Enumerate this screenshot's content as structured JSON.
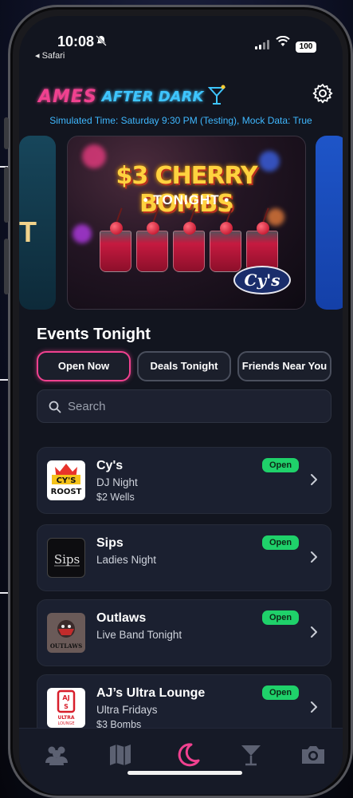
{
  "status_bar": {
    "time": "10:08",
    "back_label": "◂ Safari",
    "battery": "100"
  },
  "header": {
    "logo_part1": "AMES",
    "logo_part2": "AFTER DARK",
    "simulated_time": "Simulated Time: Saturday 9:30 PM (Testing), Mock Data: True"
  },
  "carousel": {
    "left_card_fragment": "T",
    "promo_title": "$3 CHERRY BOMBS",
    "promo_subtitle": "• TONIGHT •",
    "promo_venue": "Cy's"
  },
  "events": {
    "title": "Events Tonight",
    "filters": [
      {
        "label": "Open Now",
        "active": true
      },
      {
        "label": "Deals Tonight",
        "active": false
      },
      {
        "label": "Friends Near You",
        "active": false
      }
    ],
    "search_placeholder": "Search"
  },
  "venues": [
    {
      "name": "Cy's",
      "line2": "DJ Night",
      "line3": "$2 Wells",
      "status": "Open",
      "logo_text": "CY'S ROOST"
    },
    {
      "name": "Sips",
      "line2": "Ladies Night",
      "line3": "",
      "status": "Open",
      "logo_text": "Sips"
    },
    {
      "name": "Outlaws",
      "line2": "Live Band Tonight",
      "line3": "",
      "status": "Open",
      "logo_text": "OUTLAWS"
    },
    {
      "name": "AJ’s Ultra Lounge",
      "line2": "Ultra Fridays",
      "line3": "$3 Bombs",
      "status": "Open",
      "logo_text": "AJS ULTRA LOUNGE"
    }
  ],
  "tab_bar": {
    "tabs": [
      "friends-icon",
      "map-icon",
      "moon-icon",
      "cocktail-icon",
      "camera-icon"
    ],
    "active_tab": "moon-icon",
    "active_color": "#f0418f"
  },
  "colors": {
    "accent_pink": "#f0418f",
    "accent_blue": "#3fb8ff",
    "open_green": "#1fd16a",
    "background": "#12151f"
  }
}
